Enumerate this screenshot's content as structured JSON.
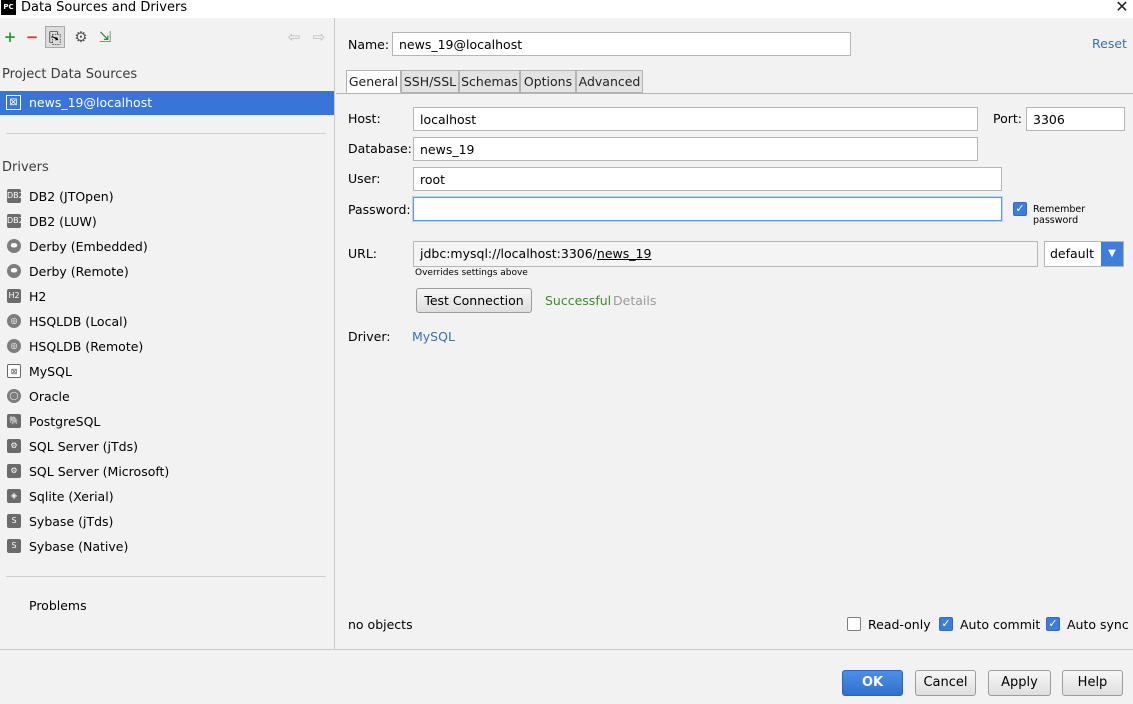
{
  "window": {
    "app_icon": "PC",
    "title": "Data Sources and Drivers",
    "close_glyph": "✕"
  },
  "left": {
    "toolbar": {
      "add": "+",
      "remove": "−",
      "copy": "⎘",
      "settings": "⚙",
      "import": "⇲",
      "back": "⇦",
      "forward": "⇨"
    },
    "project_title": "Project Data Sources",
    "data_source": "news_19@localhost",
    "drivers_title": "Drivers",
    "drivers": [
      {
        "label": "DB2 (JTOpen)",
        "icon": "db2-icon",
        "glyph": "DB2"
      },
      {
        "label": "DB2 (LUW)",
        "icon": "db2-icon",
        "glyph": "DB2"
      },
      {
        "label": "Derby (Embedded)",
        "icon": "derby-icon",
        "glyph": "⬬"
      },
      {
        "label": "Derby (Remote)",
        "icon": "derby-icon",
        "glyph": "⬬"
      },
      {
        "label": "H2",
        "icon": "h2-icon",
        "glyph": "H2"
      },
      {
        "label": "HSQLDB (Local)",
        "icon": "hsqldb-icon",
        "glyph": "◎"
      },
      {
        "label": "HSQLDB (Remote)",
        "icon": "hsqldb-icon",
        "glyph": "◎"
      },
      {
        "label": "MySQL",
        "icon": "mysql-icon",
        "glyph": "⊠"
      },
      {
        "label": "Oracle",
        "icon": "oracle-icon",
        "glyph": "◯"
      },
      {
        "label": "PostgreSQL",
        "icon": "postgresql-icon",
        "glyph": "🐘"
      },
      {
        "label": "SQL Server (jTds)",
        "icon": "sqlserver-icon",
        "glyph": "⚙"
      },
      {
        "label": "SQL Server (Microsoft)",
        "icon": "sqlserver-icon",
        "glyph": "⚙"
      },
      {
        "label": "Sqlite (Xerial)",
        "icon": "sqlite-icon",
        "glyph": "◈"
      },
      {
        "label": "Sybase (jTds)",
        "icon": "sybase-icon",
        "glyph": "S"
      },
      {
        "label": "Sybase (Native)",
        "icon": "sybase-icon",
        "glyph": "S"
      }
    ],
    "problems": "Problems"
  },
  "right": {
    "name_label": "Name:",
    "name_value": "news_19@localhost",
    "reset": "Reset",
    "tabs": [
      "General",
      "SSH/SSL",
      "Schemas",
      "Options",
      "Advanced"
    ],
    "host_label": "Host:",
    "host_value": "localhost",
    "port_label": "Port:",
    "port_value": "3306",
    "database_label": "Database:",
    "database_value": "news_19",
    "user_label": "User:",
    "user_value": "root",
    "password_label": "Password:",
    "password_value": "",
    "remember_password": "Remember password",
    "url_label": "URL:",
    "url_prefix": "jdbc:mysql://localhost:3306/",
    "url_db": "news_19",
    "url_mode": "default",
    "url_hint": "Overrides settings above",
    "test_connection": "Test Connection",
    "status": "Successful",
    "details": "Details",
    "driver_label": "Driver:",
    "driver_value": "MySQL",
    "objects": "no objects",
    "read_only": "Read-only",
    "auto_commit": "Auto commit",
    "auto_sync": "Auto sync"
  },
  "buttons": {
    "ok": "OK",
    "cancel": "Cancel",
    "apply": "Apply",
    "help": "Help"
  },
  "colors": {
    "selection": "#3875d6",
    "link": "#3b6fb1",
    "success": "#3d8a2a",
    "accent": "#3c7ed8"
  }
}
